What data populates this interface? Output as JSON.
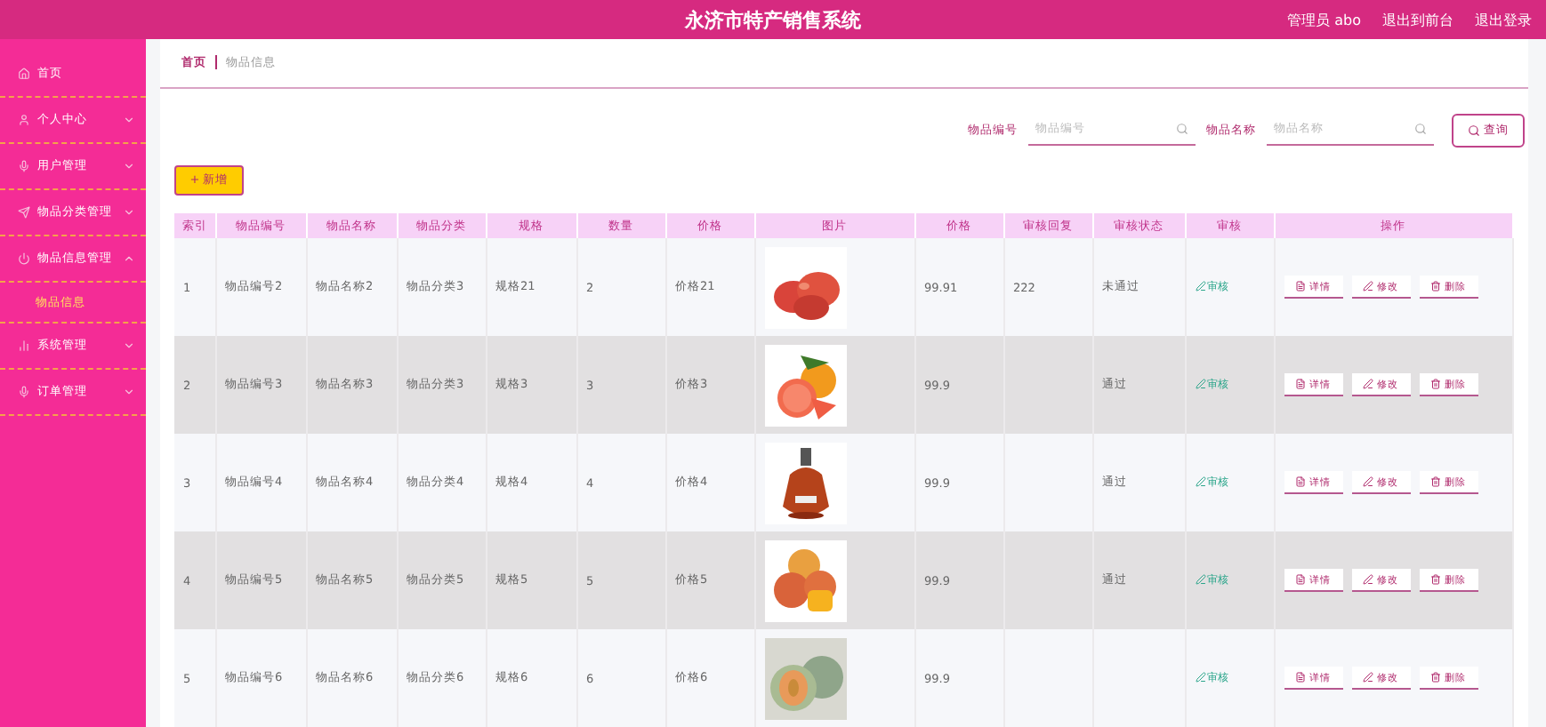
{
  "header": {
    "title": "永济市特产销售系统",
    "links": [
      "管理员 abo",
      "退出到前台",
      "退出登录"
    ]
  },
  "sidebar": {
    "items": [
      {
        "label": "首页",
        "expandable": false
      },
      {
        "label": "个人中心",
        "expandable": true,
        "expanded": false
      },
      {
        "label": "用户管理",
        "expandable": true,
        "expanded": false
      },
      {
        "label": "物品分类管理",
        "expandable": true,
        "expanded": false
      },
      {
        "label": "物品信息管理",
        "expandable": true,
        "expanded": true,
        "children": [
          {
            "label": "物品信息",
            "selected": true
          }
        ]
      },
      {
        "label": "系统管理",
        "expandable": true,
        "expanded": false
      },
      {
        "label": "订单管理",
        "expandable": true,
        "expanded": false
      }
    ]
  },
  "breadcrumb": [
    "首页",
    "物品信息"
  ],
  "search": {
    "fields": [
      {
        "label": "物品编号",
        "placeholder": "物品编号"
      },
      {
        "label": "物品名称",
        "placeholder": "物品名称"
      }
    ],
    "button": "查询"
  },
  "add_button": "+ 新增",
  "table": {
    "columns": [
      "索引",
      "物品编号",
      "物品名称",
      "物品分类",
      "规格",
      "数量",
      "价格",
      "图片",
      "价格",
      "审核回复",
      "审核状态",
      "审核",
      "操作"
    ],
    "rows": [
      {
        "cells": [
          "1",
          "物品编号2",
          "物品名称2",
          "物品分类3",
          "规格21",
          "2",
          "价格21"
        ],
        "price": "99.91",
        "reply": "222",
        "status": "未通过",
        "audit": "审核",
        "actions": [
          "详情",
          "修改",
          "删除"
        ]
      },
      {
        "cells": [
          "2",
          "物品编号3",
          "物品名称3",
          "物品分类3",
          "规格3",
          "3",
          "价格3"
        ],
        "price": "99.9",
        "status": "通过",
        "audit": "审核",
        "actions": [
          "详情",
          "修改",
          "删除"
        ]
      },
      {
        "cells": [
          "3",
          "物品编号4",
          "物品名称4",
          "物品分类4",
          "规格4",
          "4",
          "价格4"
        ],
        "price": "99.9",
        "status": "通过",
        "audit": "审核",
        "actions": [
          "详情",
          "修改",
          "删除"
        ]
      },
      {
        "cells": [
          "4",
          "物品编号5",
          "物品名称5",
          "物品分类5",
          "规格5",
          "5",
          "价格5"
        ],
        "price": "99.9",
        "status": "通过",
        "audit": "审核",
        "actions": [
          "详情",
          "修改",
          "删除"
        ]
      },
      {
        "cells": [
          "5",
          "物品编号6",
          "物品名称6",
          "物品分类6",
          "规格6",
          "6",
          "价格6"
        ],
        "price": "99.9",
        "audit": "审核",
        "actions": [
          "详情",
          "修改",
          "删除"
        ]
      }
    ]
  }
}
